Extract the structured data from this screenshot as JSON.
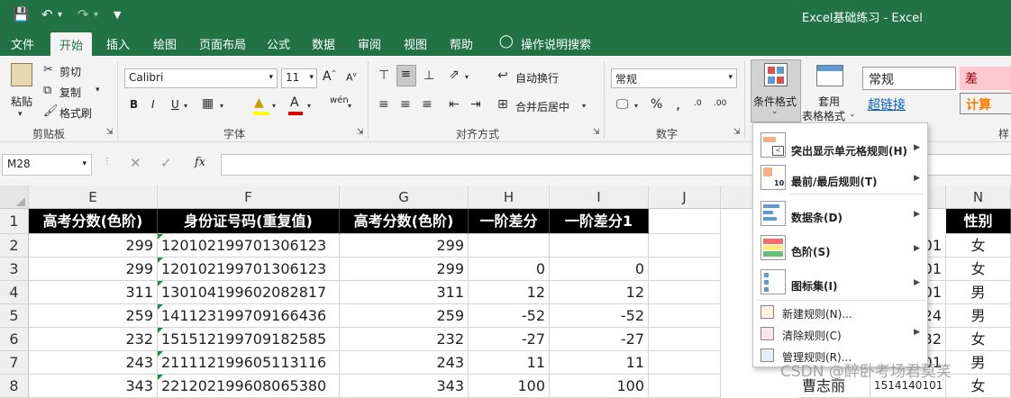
{
  "window": {
    "title": "Excel基础练习  -  Excel"
  },
  "ribbon_tabs": [
    "文件",
    "开始",
    "插入",
    "绘图",
    "页面布局",
    "公式",
    "数据",
    "审阅",
    "视图",
    "帮助",
    "操作说明搜索"
  ],
  "clipboard": {
    "paste": "粘贴",
    "cut": "剪切",
    "copy": "复制",
    "format_painter": "格式刷",
    "group": "剪贴板"
  },
  "font": {
    "name": "Calibri",
    "size": "11",
    "group": "字体",
    "bold": "B",
    "italic": "I",
    "underline": "U"
  },
  "alignment": {
    "wrap": "自动换行",
    "merge": "合并后居中",
    "group": "对齐方式"
  },
  "number": {
    "format": "常规",
    "group": "数字",
    "percent": "%"
  },
  "styles": {
    "conditional": "条件格式",
    "table_line1": "套用",
    "table_line2": "表格格式",
    "normal": "常规",
    "bad": "差",
    "hyperlink": "超链接",
    "calc": "计算",
    "partial": "样"
  },
  "formula_bar": {
    "name_box": "M28",
    "fx": "fx",
    "value": ""
  },
  "columns": [
    "E",
    "F",
    "G",
    "H",
    "I",
    "J",
    "N"
  ],
  "rows": [
    "1",
    "2",
    "3",
    "4",
    "5",
    "6",
    "7",
    "8"
  ],
  "table": {
    "headers": [
      "高考分数(色阶)",
      "身份证号码(重复值)",
      "高考分数(色阶)",
      "一阶差分",
      "一阶差分1"
    ],
    "rows": [
      [
        "299",
        "12010219970130612​3",
        "299",
        "",
        ""
      ],
      [
        "299",
        "120102199701306123",
        "299",
        "0",
        "0"
      ],
      [
        "311",
        "130104199602082817",
        "311",
        "12",
        "12"
      ],
      [
        "259",
        "141123199709166436",
        "259",
        "-52",
        "-52"
      ],
      [
        "232",
        "151512199709182585",
        "232",
        "-27",
        "-27"
      ],
      [
        "243",
        "211112199605113116",
        "243",
        "11",
        "11"
      ],
      [
        "343",
        "221202199608065380",
        "343",
        "100",
        "100"
      ]
    ]
  },
  "right_partial": {
    "header": "性别",
    "m_values": [
      "01",
      "01",
      "01",
      "24",
      "32",
      "01",
      "1514140101"
    ],
    "m_name_row8": "曹志丽",
    "genders": [
      "女",
      "女",
      "男",
      "男",
      "女",
      "男",
      "女"
    ]
  },
  "menu": {
    "items": [
      {
        "label": "突出显示单元格规则(H)",
        "icon": "highlight-rules-icon",
        "submenu": true
      },
      {
        "label": "最前/最后规则(T)",
        "icon": "top-bottom-rules-icon",
        "submenu": true
      },
      {
        "label": "数据条(D)",
        "icon": "data-bars-icon",
        "submenu": true
      },
      {
        "label": "色阶(S)",
        "icon": "color-scales-icon",
        "submenu": true
      },
      {
        "label": "图标集(I)",
        "icon": "icon-sets-icon",
        "submenu": true
      },
      {
        "label": "新建规则(N)...",
        "icon": "new-rule-icon",
        "submenu": false
      },
      {
        "label": "清除规则(C)",
        "icon": "clear-rules-icon",
        "submenu": true
      },
      {
        "label": "管理规则(R)...",
        "icon": "manage-rules-icon",
        "submenu": false
      }
    ]
  },
  "watermark": "CSDN @醉卧考场君莫笑",
  "colors": {
    "excel_green": "#217346",
    "header_black": "#000000",
    "bad_fill": "#ffc7ce",
    "calc_text": "#fa7d00"
  }
}
